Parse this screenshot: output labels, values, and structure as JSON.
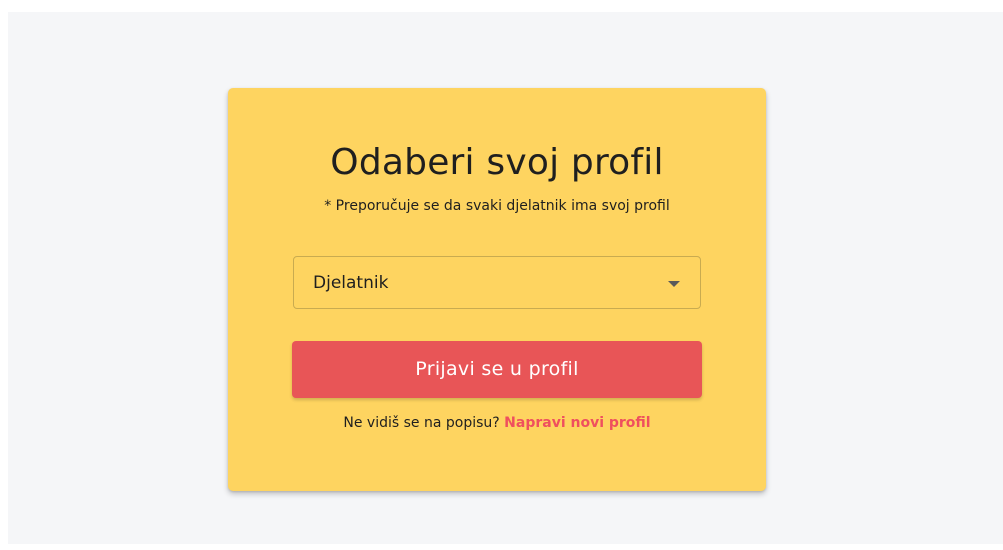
{
  "card": {
    "title": "Odaberi svoj profil",
    "subtitle": "* Preporučuje se da svaki djelatnik ima svoj profil"
  },
  "profile_select": {
    "selected_value": "Djelatnik",
    "icon": "chevron-down-icon"
  },
  "login_button": {
    "label": "Prijavi se u profil"
  },
  "footer": {
    "prompt": "Ne vidiš se na popisu?",
    "create_link": "Napravi novi profil"
  },
  "colors": {
    "page_background": "#f5f6f8",
    "card_background": "#fed460",
    "button_background": "#e85557",
    "link_color": "#ef4f5e"
  }
}
